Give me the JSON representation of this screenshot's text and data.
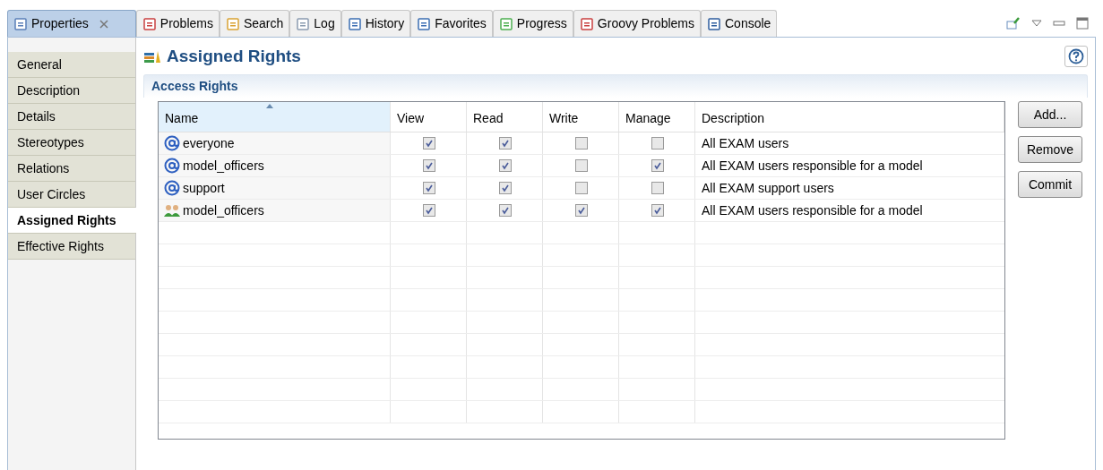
{
  "tabs": [
    {
      "label": "Properties",
      "selected": true,
      "closable": true
    },
    {
      "label": "Problems",
      "selected": false
    },
    {
      "label": "Search",
      "selected": false
    },
    {
      "label": "Log",
      "selected": false
    },
    {
      "label": "History",
      "selected": false
    },
    {
      "label": "Favorites",
      "selected": false
    },
    {
      "label": "Progress",
      "selected": false
    },
    {
      "label": "Groovy Problems",
      "selected": false
    },
    {
      "label": "Console",
      "selected": false
    }
  ],
  "sidebar": {
    "items": [
      {
        "label": "General",
        "selected": false
      },
      {
        "label": "Description",
        "selected": false
      },
      {
        "label": "Details",
        "selected": false
      },
      {
        "label": "Stereotypes",
        "selected": false
      },
      {
        "label": "Relations",
        "selected": false
      },
      {
        "label": "User Circles",
        "selected": false
      },
      {
        "label": "Assigned Rights",
        "selected": true
      },
      {
        "label": "Effective Rights",
        "selected": false
      }
    ]
  },
  "title": "Assigned Rights",
  "section": {
    "title": "Access Rights"
  },
  "table": {
    "columns": [
      "Name",
      "View",
      "Read",
      "Write",
      "Manage",
      "Description"
    ],
    "rows": [
      {
        "kind": "user",
        "name": "everyone",
        "view": true,
        "read": true,
        "write": false,
        "manage": false,
        "description": "All EXAM users"
      },
      {
        "kind": "user",
        "name": "model_officers",
        "view": true,
        "read": true,
        "write": false,
        "manage": true,
        "description": "All EXAM users responsible for a model"
      },
      {
        "kind": "user",
        "name": "support",
        "view": true,
        "read": true,
        "write": false,
        "manage": false,
        "description": "All EXAM support users"
      },
      {
        "kind": "group",
        "name": "model_officers",
        "view": true,
        "read": true,
        "write": true,
        "manage": true,
        "description": "All EXAM users responsible for a model"
      }
    ]
  },
  "buttons": [
    "Add...",
    "Remove",
    "Commit"
  ]
}
